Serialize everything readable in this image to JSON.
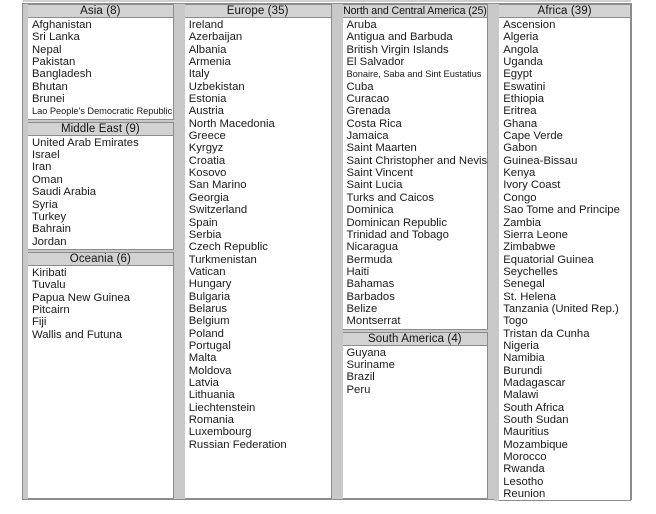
{
  "table": {
    "columns": [
      {
        "id": "column-asia",
        "groups": [
          {
            "id": "group-asia",
            "header": "Asia (8)",
            "count": 8,
            "items": [
              "Afghanistan",
              "Sri Lanka",
              "Nepal",
              "Pakistan",
              "Bangladesh",
              "Bhutan",
              "Brunei",
              "Lao People's Democratic Republic"
            ]
          },
          {
            "id": "group-middle-east",
            "header": "Middle East (9)",
            "count": 9,
            "items": [
              "United Arab Emirates",
              "Israel",
              "Iran",
              "Oman",
              "Saudi Arabia",
              "Syria",
              "Turkey",
              "Bahrain",
              "Jordan"
            ]
          },
          {
            "id": "group-oceania",
            "header": "Oceania (6)",
            "count": 6,
            "items": [
              "Kiribati",
              "Tuvalu",
              "Papua New Guinea",
              "Pitcairn",
              "Fiji",
              "Wallis and Futuna"
            ]
          }
        ]
      },
      {
        "id": "column-europe",
        "groups": [
          {
            "id": "group-europe",
            "header": "Europe (35)",
            "count": 35,
            "items": [
              "Ireland",
              "Azerbaijan",
              "Albania",
              "Armenia",
              "Italy",
              "Uzbekistan",
              "Estonia",
              "Austria",
              "North Macedonia",
              "Greece",
              "Kyrgyz",
              "Croatia",
              "Kosovo",
              "San Marino",
              "Georgia",
              "Switzerland",
              "Spain",
              "Serbia",
              "Czech Republic",
              "Turkmenistan",
              "Vatican",
              "Hungary",
              "Bulgaria",
              "Belarus",
              "Belgium",
              "Poland",
              "Portugal",
              "Malta",
              "Moldova",
              "Latvia",
              "Lithuania",
              "Liechtenstein",
              "Romania",
              "Luxembourg",
              "Russian Federation"
            ]
          }
        ]
      },
      {
        "id": "column-americas",
        "groups": [
          {
            "id": "group-north-central-america",
            "header": "North and Central America (25)",
            "count": 25,
            "items": [
              "Aruba",
              "Antigua and Barbuda",
              "British Virgin Islands",
              "El Salvador",
              "Bonaire, Saba and Sint Eustatius",
              "Cuba",
              "Curacao",
              "Grenada",
              "Costa Rica",
              "Jamaica",
              "Saint Maarten",
              "Saint Christopher and Nevis",
              "Saint Vincent",
              "Saint Lucia",
              "Turks and Caicos",
              "Dominica",
              "Dominican Republic",
              "Trinidad and Tobago",
              "Nicaragua",
              "Bermuda",
              "Haiti",
              "Bahamas",
              "Barbados",
              "Belize",
              "Montserrat"
            ]
          },
          {
            "id": "group-south-america",
            "header": "South America (4)",
            "count": 4,
            "items": [
              "Guyana",
              "Suriname",
              "Brazil",
              "Peru"
            ]
          }
        ]
      },
      {
        "id": "column-africa",
        "groups": [
          {
            "id": "group-africa",
            "header": "Africa (39)",
            "count": 39,
            "items": [
              "Ascension",
              "Algeria",
              "Angola",
              "Uganda",
              "Egypt",
              "Eswatini",
              "Ethiopia",
              "Eritrea",
              "Ghana",
              "Cape Verde",
              "Gabon",
              "Guinea-Bissau",
              "Kenya",
              "Ivory Coast",
              "Congo",
              "Sao Tome and Principe",
              "Zambia",
              "Sierra Leone",
              "Zimbabwe",
              "Equatorial Guinea",
              "Seychelles",
              "Senegal",
              "St. Helena",
              "Tanzania (United Rep.)",
              "Togo",
              "Tristan da Cunha",
              "Nigeria",
              "Namibia",
              "Burundi",
              "Madagascar",
              "Malawi",
              "South Africa",
              "South Sudan",
              "Mauritius",
              "Mozambique",
              "Morocco",
              "Rwanda",
              "Lesotho",
              "Reunion"
            ]
          }
        ]
      }
    ]
  },
  "colors": {
    "header_background": "#d2d2d2",
    "border": "#8c8c8c",
    "divider": "#c8c8c8",
    "page_background": "#ffffff",
    "text": "#1a1a1a"
  }
}
